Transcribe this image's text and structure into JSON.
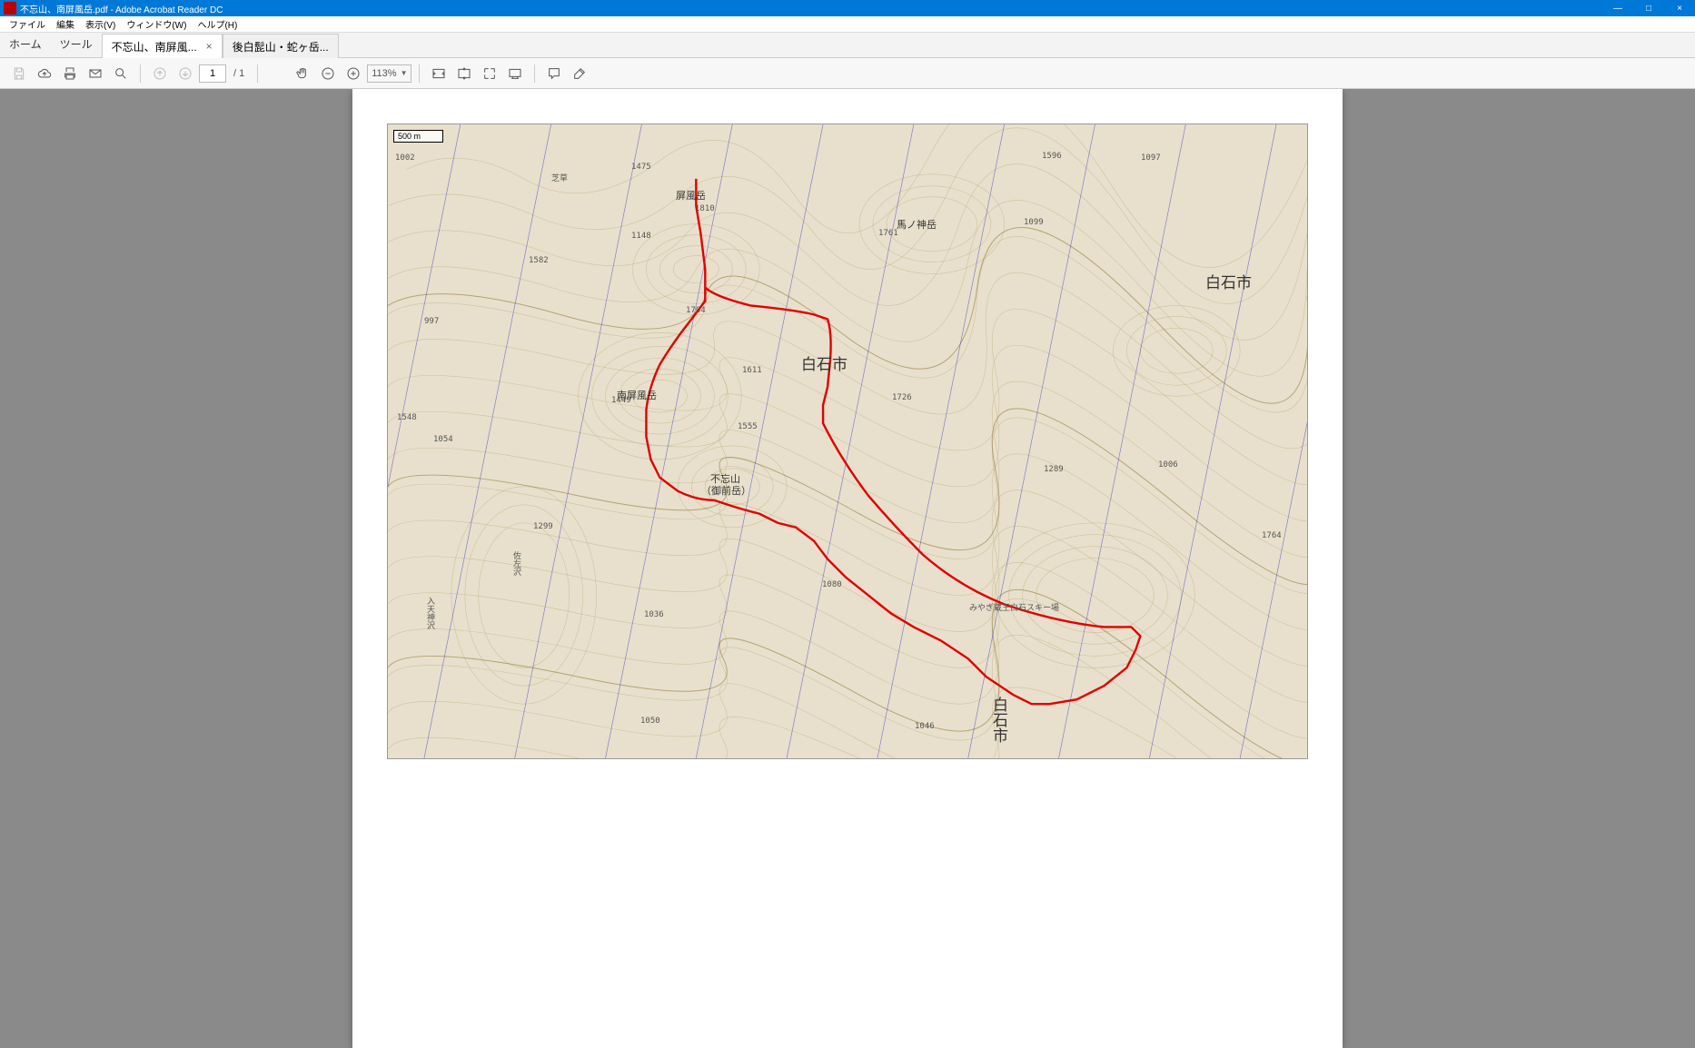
{
  "window": {
    "title": "不忘山、南屏風岳.pdf - Adobe Acrobat Reader DC",
    "min_label": "—",
    "max_label": "□",
    "close_label": "×"
  },
  "menu": {
    "file": "ファイル",
    "edit": "編集",
    "view": "表示(V)",
    "window": "ウィンドウ(W)",
    "help": "ヘルプ(H)"
  },
  "nav": {
    "home": "ホーム",
    "tools": "ツール"
  },
  "tabs": [
    {
      "label": "不忘山、南屏風...",
      "active": true
    },
    {
      "label": "後白髭山・蛇ヶ岳...",
      "active": false
    }
  ],
  "toolbar": {
    "page_current": "1",
    "page_count": "/ 1",
    "zoom": "113%"
  },
  "map": {
    "scale": "500 m",
    "labels": {
      "city1": "白石市",
      "city2": "白石市",
      "city3": "白石市",
      "byobudake": "屏風岳",
      "minamibyobudake": "南屏風岳",
      "fubosan1": "不忘山",
      "fubosan2": "（御前岳）",
      "umakami": "馬ノ神岳",
      "shibakusa": "芝草",
      "ski": "みやぎ蔵王白石スキー場",
      "nyuten": "入天神沢",
      "sasozawa": "佐左沢"
    },
    "elevations": [
      "1002",
      "1475",
      "1548",
      "1582",
      "997",
      "1054",
      "1050",
      "1080",
      "1148",
      "1299",
      "1046",
      "1449",
      "1555",
      "1704",
      "1726",
      "1761",
      "1611",
      "1810",
      "1596",
      "1289",
      "1006",
      "1097",
      "1764",
      "1036",
      "1099"
    ]
  }
}
